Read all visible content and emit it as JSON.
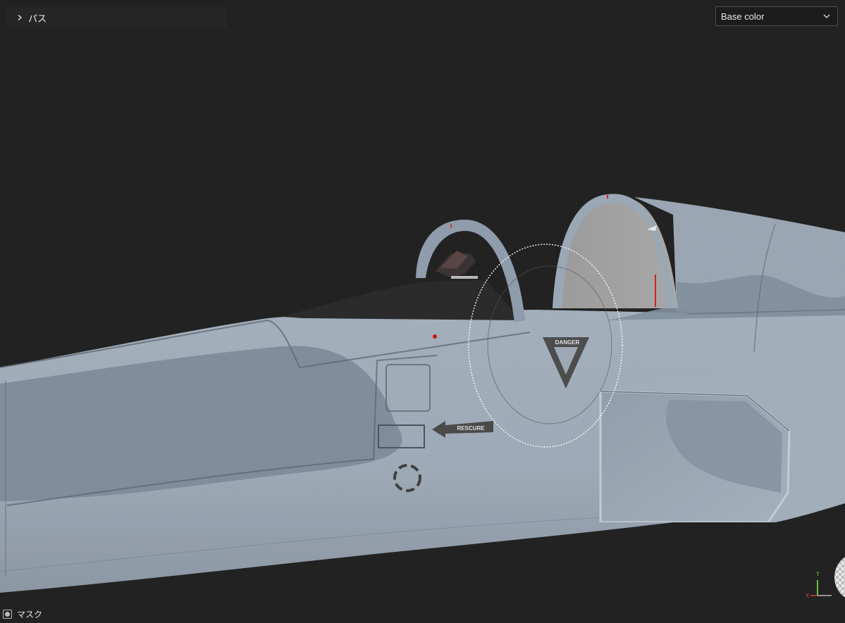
{
  "path_panel": {
    "label": "パス",
    "expand_icon": "chevron-right-icon"
  },
  "channel_dropdown": {
    "selected": "Base color",
    "icon": "chevron-down-icon"
  },
  "mask_toggle": {
    "label": "マスク",
    "icon": "mask-icon"
  },
  "decals": {
    "danger": "DANGER",
    "rescue": "RESCURE"
  },
  "axis_gizmo": {
    "x_label": "X",
    "y_label": "Y",
    "x_color": "#d04040",
    "y_color": "#70c040"
  },
  "colors": {
    "background": "#222222",
    "fuselage": "#9ca9b6",
    "fuselage_dark": "#7c8b99",
    "canopy_glass": "#8a8a8a",
    "canopy_dark": "#2a2a2a",
    "brush_cursor": "#ffffff"
  }
}
